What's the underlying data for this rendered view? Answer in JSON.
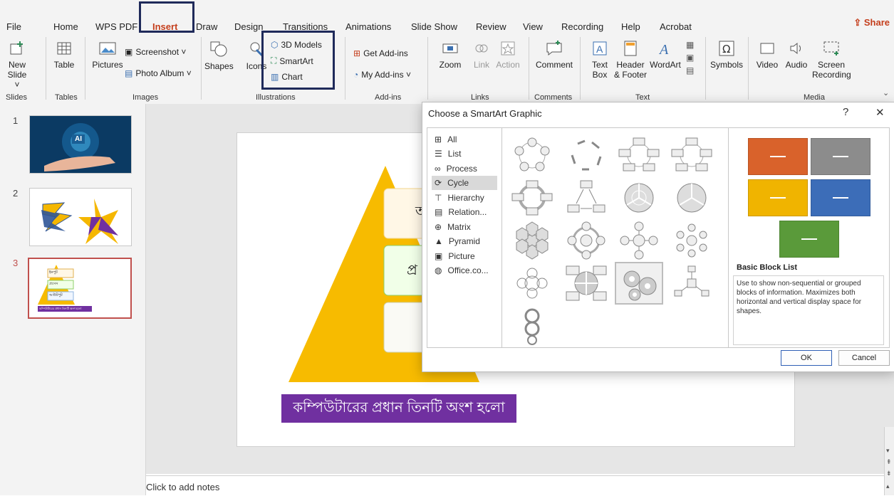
{
  "menu": {
    "items": [
      "File",
      "Home",
      "WPS PDF",
      "Insert",
      "Draw",
      "Design",
      "Transitions",
      "Animations",
      "Slide Show",
      "Review",
      "View",
      "Recording",
      "Help",
      "Acrobat"
    ],
    "active": "Insert",
    "share": "Share"
  },
  "ribbon": {
    "new_slide": "New Slide ˅",
    "table": "Table",
    "pictures": "Pictures",
    "screenshot": "Screenshot ˅",
    "photo_album": "Photo Album ˅",
    "shapes": "Shapes",
    "icons": "Icons",
    "models_3d": "3D Models",
    "smartart": "SmartArt",
    "chart": "Chart",
    "get_addins": "Get Add-ins",
    "my_addins": "My Add-ins ˅",
    "zoom": "Zoom",
    "link": "Link",
    "action": "Action",
    "comment": "Comment",
    "text_box": "Text Box",
    "header_footer": "Header & Footer",
    "wordart": "WordArt",
    "symbols": "Symbols",
    "video": "Video",
    "audio": "Audio",
    "screen_recording": "Screen Recording",
    "groups": {
      "slides": "Slides",
      "tables": "Tables",
      "images": "Images",
      "illustrations": "Illustrations",
      "addins": "Add-ins",
      "links": "Links",
      "comments": "Comments",
      "text": "Text",
      "media": "Media"
    }
  },
  "slides": {
    "numbers": [
      "1",
      "2",
      "3"
    ],
    "thumb1_badge": "AI",
    "thumb3_boxes": [
      "ইনপুট",
      "প্রসেস",
      "আউটপুট"
    ],
    "thumb3_caption": "কম্পিউটারের প্রধান তিনটি অংশ হলো"
  },
  "slide": {
    "caption": "কম্পিউটারের প্রধান তিনটি অংশ হলো",
    "box1_fragment": "অ",
    "box2_fragment": "প্র"
  },
  "notes": {
    "placeholder": "Click to add notes"
  },
  "dialog": {
    "title": "Choose a SmartArt Graphic",
    "help": "?",
    "close": "✕",
    "categories": [
      "All",
      "List",
      "Process",
      "Cycle",
      "Hierarchy",
      "Relation...",
      "Matrix",
      "Pyramid",
      "Picture",
      "Office.co..."
    ],
    "selected_category": "Cycle",
    "preview_title": "Basic Block List",
    "preview_description": "Use to show non-sequential or grouped blocks of information. Maximizes both horizontal and vertical display space for shapes.",
    "preview_colors": [
      "#d9622b",
      "#8c8c8c",
      "#f0b400",
      "#3c6db8",
      "#5a9a3a"
    ],
    "ok": "OK",
    "cancel": "Cancel"
  },
  "colors": {
    "accent": "#c43e1c",
    "highlight": "#1f2a5a",
    "slide_caption_bg": "#7030a0",
    "pyramid": "#f7bb00"
  }
}
